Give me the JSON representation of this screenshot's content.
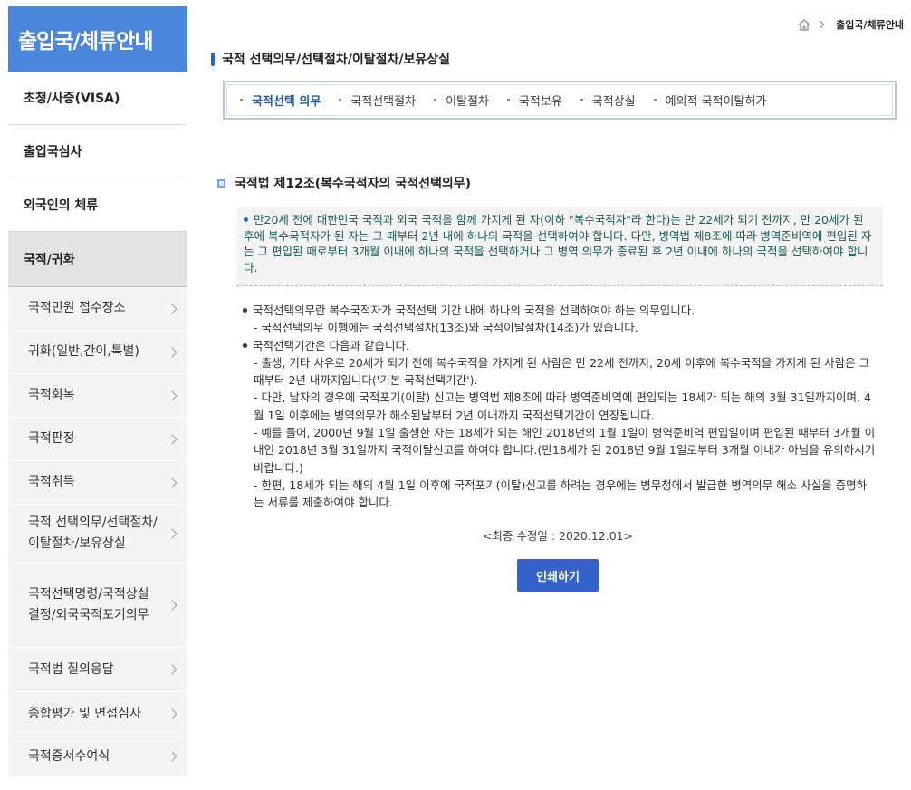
{
  "sidebar": {
    "heading": "출입국/체류안내",
    "top_items": [
      {
        "label": "초청/사증(VISA)"
      },
      {
        "label": "출입국심사"
      },
      {
        "label": "외국인의 체류"
      },
      {
        "label": "국적/귀화"
      }
    ],
    "sub_items": [
      {
        "label": "국적민원 접수장소"
      },
      {
        "label": "귀화(일반,간이,특별)"
      },
      {
        "label": "국적회복"
      },
      {
        "label": "국적판정"
      },
      {
        "label": "국적취득"
      },
      {
        "label": "국적 선택의무/선택절차/이탈절차/보유상실"
      },
      {
        "label": "국적선택명령/국적상실결정/외국국적포기의무"
      },
      {
        "label": "국적법 질의응답"
      },
      {
        "label": "종합평가 및 면접심사"
      },
      {
        "label": "국적증서수여식"
      }
    ]
  },
  "breadcrumb": {
    "home_icon": "home-icon",
    "current": "출입국/체류안내"
  },
  "page": {
    "title": "국적 선택의무/선택절차/이탈절차/보유상실",
    "tabs": [
      {
        "label": "국적선택 의무",
        "active": true
      },
      {
        "label": "국적선택절차"
      },
      {
        "label": "이탈절차"
      },
      {
        "label": "국적보유"
      },
      {
        "label": "국적상실"
      },
      {
        "label": "예외적 국적이탈허가"
      }
    ],
    "section_title": "국적법 제12조(복수국적자의 국적선택의무)",
    "notice": "만20세 전에 대한민국 국적과 외국 국적을 함께 가지게 된 자(이하 \"복수국적자\"라 한다)는 만 22세가 되기 전까지, 만 20세가 된 후에 복수국적자가 된 자는 그 때부터 2년 내에 하나의 국적을 선택하여야 합니다. 다만, 병역법 제8조에 따라 병역준비역에 편입된 자는 그 편입된 때로부터 3개월 이내에 하나의 국적을 선택하거나 그 병역 의무가 종료된 후 2년 이내에 하나의 국적을 선택하여야 합니다.",
    "body": [
      {
        "bullet": "국적선택의무란 복수국적자가 국적선택 기간 내에 하나의 국적을 선택하여야 하는 의무입니다.",
        "lines": [
          "- 국적선택의무 이행에는 국적선택절차(13조)와 국적이탈절차(14조)가 있습니다."
        ]
      },
      {
        "bullet": "국적선택기간은 다음과 같습니다.",
        "lines": [
          "- 출생, 기타 사유로 20세가 되기 전에 복수국적을 가지게 된 사람은 만 22세 전까지, 20세 이후에 복수국적을 가지게 된 사람은 그 때부터 2년 내까지입니다('기본 국적선택기간').",
          "- 다만, 남자의 경우에 국적포기(이탈) 신고는 병역법 제8조에 따라 병역준비역에 편입되는 18세가 되는 해의 3월 31일까지이며, 4월 1일 이후에는 병역의무가 해소된날부터 2년 이내까지 국적선택기간이 연장됩니다.",
          "- 예를 들어, 2000년 9월 1일 출생한 자는 18세가 되는 해인 2018년의 1월 1일이 병역준비역 편입일이며 편입된 때부터 3개월 이내인 2018년 3월 31일까지 국적이탈신고를 하여야 합니다.(만18세가 된 2018년 9월 1일로부터 3개월 이내가 아님을 유의하시기 바랍니다.)",
          "- 한편, 18세가 되는 해의 4월 1일 이후에 국적포기(이탈)신고를 하려는 경우에는 병무청에서 발급한 병역의무 해소 사실을 증명하는 서류를 제출하여야 합니다."
        ]
      }
    ],
    "last_modified": "<최종 수정일 : 2020.12.01>",
    "print_label": "인쇄하기"
  },
  "colors": {
    "accent": "#4a86d9",
    "button": "#3562c9",
    "active_tab": "#1f5faa",
    "notice_text": "#1b5c5c"
  }
}
